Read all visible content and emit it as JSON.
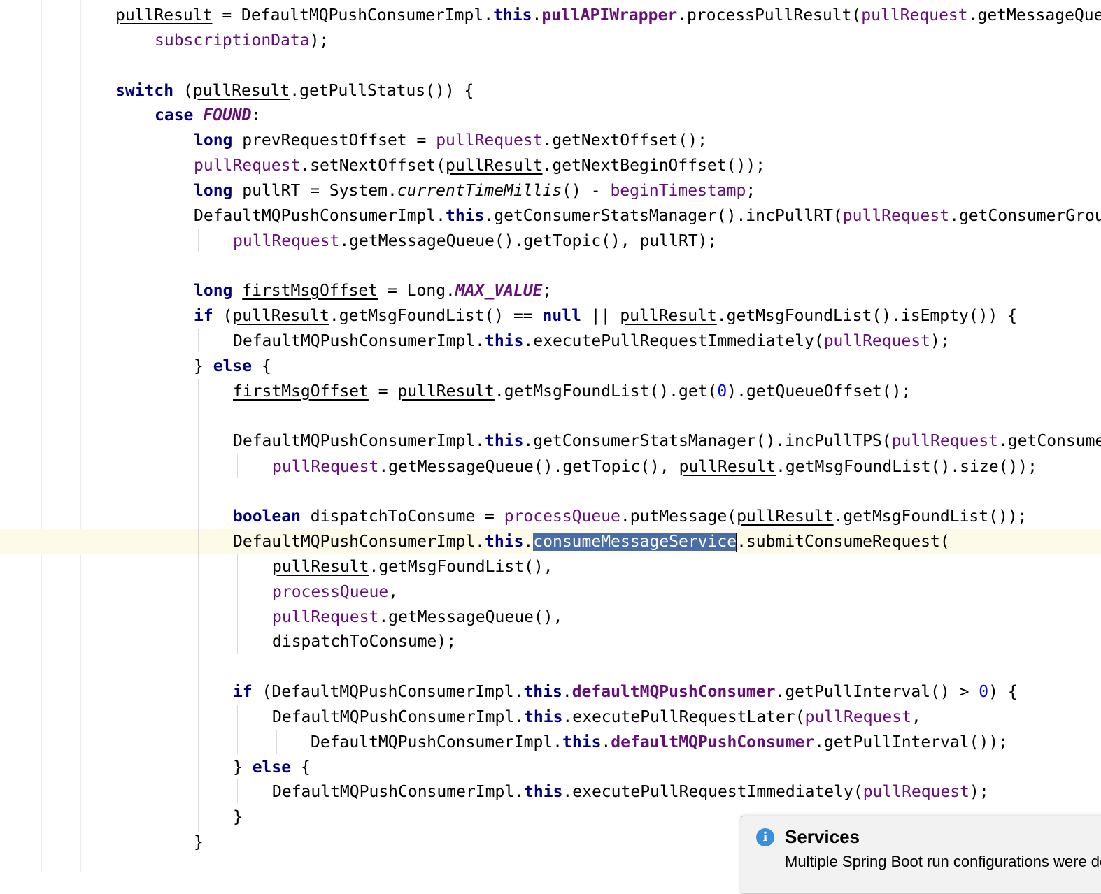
{
  "editor": {
    "code_lines": [
      "pullResult = DefaultMQPushConsumerImpl.this.pullAPIWrapper.processPullResult(pullRequest.getMessageQueue(), pullResult,",
      "subscriptionData);",
      "switch (pullResult.getPullStatus()) {",
      "case FOUND:",
      "long prevRequestOffset = pullRequest.getNextOffset();",
      "pullRequest.setNextOffset(pullResult.getNextBeginOffset());",
      "long pullRT = System.currentTimeMillis() - beginTimestamp;",
      "DefaultMQPushConsumerImpl.this.getConsumerStatsManager().incPullRT(pullRequest.getConsumerGroup(),",
      "pullRequest.getMessageQueue().getTopic(), pullRT);",
      "long firstMsgOffset = Long.MAX_VALUE;",
      "if (pullResult.getMsgFoundList() == null || pullResult.getMsgFoundList().isEmpty()) {",
      "DefaultMQPushConsumerImpl.this.executePullRequestImmediately(pullRequest);",
      "} else {",
      "firstMsgOffset = pullResult.getMsgFoundList().get(0).getQueueOffset();",
      "DefaultMQPushConsumerImpl.this.getConsumerStatsManager().incPullTPS(pullRequest.getConsumerGroup(),",
      "pullRequest.getMessageQueue().getTopic(), pullResult.getMsgFoundList().size());",
      "boolean dispatchToConsume = processQueue.putMessage(pullResult.getMsgFoundList());",
      "DefaultMQPushConsumerImpl.this.consumeMessageService.submitConsumeRequest(",
      "pullResult.getMsgFoundList(),",
      "processQueue,",
      "pullRequest.getMessageQueue(),",
      "dispatchToConsume);",
      "if (DefaultMQPushConsumerImpl.this.defaultMQPushConsumer.getPullInterval() > 0) {",
      "DefaultMQPushConsumerImpl.this.executePullRequestLater(pullRequest,",
      "DefaultMQPushConsumerImpl.this.defaultMQPushConsumer.getPullInterval());",
      "} else {",
      "DefaultMQPushConsumerImpl.this.executePullRequestImmediately(pullRequest);",
      "}",
      "}"
    ],
    "selected_text": "consumeMessageService",
    "current_line": "DefaultMQPushConsumerImpl.this.consumeMessageService.submitConsumeRequest("
  },
  "notification": {
    "icon": "info-icon",
    "title": "Services",
    "message": "Multiple Spring Boot run configurations were detected."
  },
  "colors": {
    "keyword": "#000080",
    "field": "#660e7a",
    "number": "#0000ff",
    "selection": "#4a6da7",
    "current_line": "#fdfbe8",
    "info_icon": "#3d8fd9"
  }
}
